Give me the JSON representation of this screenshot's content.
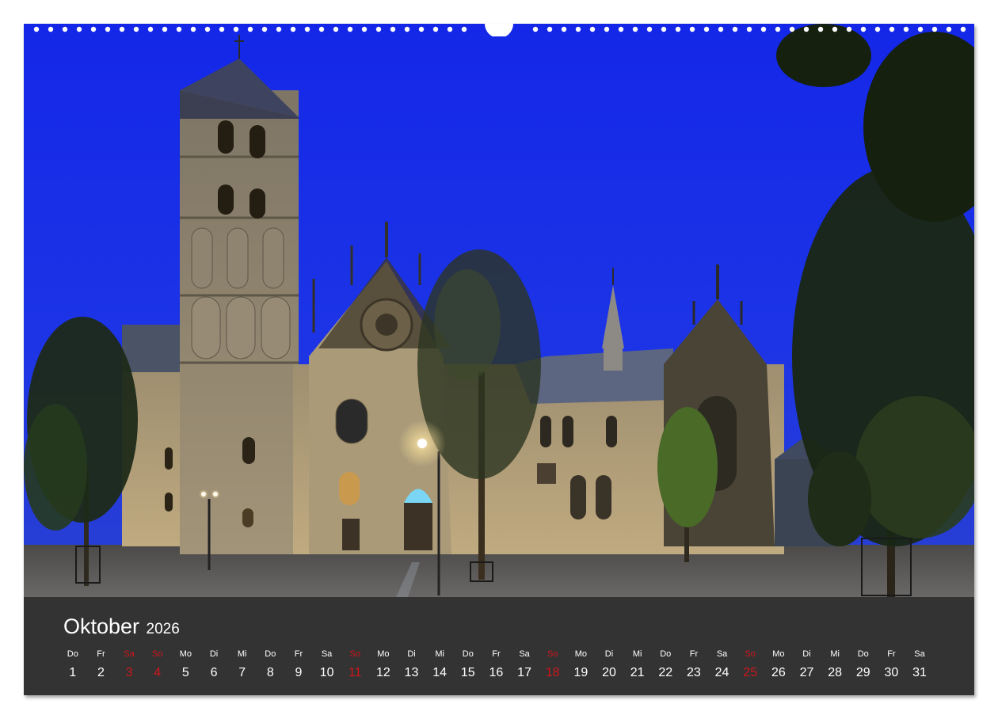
{
  "calendar": {
    "month": "Oktober",
    "year": "2026",
    "days": [
      {
        "weekday": "Do",
        "day": "1",
        "holiday": false
      },
      {
        "weekday": "Fr",
        "day": "2",
        "holiday": false
      },
      {
        "weekday": "Sa",
        "day": "3",
        "holiday": true
      },
      {
        "weekday": "So",
        "day": "4",
        "holiday": true
      },
      {
        "weekday": "Mo",
        "day": "5",
        "holiday": false
      },
      {
        "weekday": "Di",
        "day": "6",
        "holiday": false
      },
      {
        "weekday": "Mi",
        "day": "7",
        "holiday": false
      },
      {
        "weekday": "Do",
        "day": "8",
        "holiday": false
      },
      {
        "weekday": "Fr",
        "day": "9",
        "holiday": false
      },
      {
        "weekday": "Sa",
        "day": "10",
        "holiday": false
      },
      {
        "weekday": "So",
        "day": "11",
        "holiday": true
      },
      {
        "weekday": "Mo",
        "day": "12",
        "holiday": false
      },
      {
        "weekday": "Di",
        "day": "13",
        "holiday": false
      },
      {
        "weekday": "Mi",
        "day": "14",
        "holiday": false
      },
      {
        "weekday": "Do",
        "day": "15",
        "holiday": false
      },
      {
        "weekday": "Fr",
        "day": "16",
        "holiday": false
      },
      {
        "weekday": "Sa",
        "day": "17",
        "holiday": false
      },
      {
        "weekday": "So",
        "day": "18",
        "holiday": true
      },
      {
        "weekday": "Mo",
        "day": "19",
        "holiday": false
      },
      {
        "weekday": "Di",
        "day": "20",
        "holiday": false
      },
      {
        "weekday": "Mi",
        "day": "21",
        "holiday": false
      },
      {
        "weekday": "Do",
        "day": "22",
        "holiday": false
      },
      {
        "weekday": "Fr",
        "day": "23",
        "holiday": false
      },
      {
        "weekday": "Sa",
        "day": "24",
        "holiday": false
      },
      {
        "weekday": "So",
        "day": "25",
        "holiday": true
      },
      {
        "weekday": "Mo",
        "day": "26",
        "holiday": false
      },
      {
        "weekday": "Di",
        "day": "27",
        "holiday": false
      },
      {
        "weekday": "Mi",
        "day": "28",
        "holiday": false
      },
      {
        "weekday": "Do",
        "day": "29",
        "holiday": false
      },
      {
        "weekday": "Fr",
        "day": "30",
        "holiday": false
      },
      {
        "weekday": "Sa",
        "day": "31",
        "holiday": false
      }
    ]
  },
  "colors": {
    "sky": "#1a2cf0",
    "panel": "#333333",
    "text": "#ffffff",
    "holiday": "#d0161b"
  },
  "photo": {
    "subject-icons": [
      "cathedral-tower-icon",
      "gothic-facade-icon",
      "street-lamp-icon",
      "tree-icon"
    ]
  }
}
